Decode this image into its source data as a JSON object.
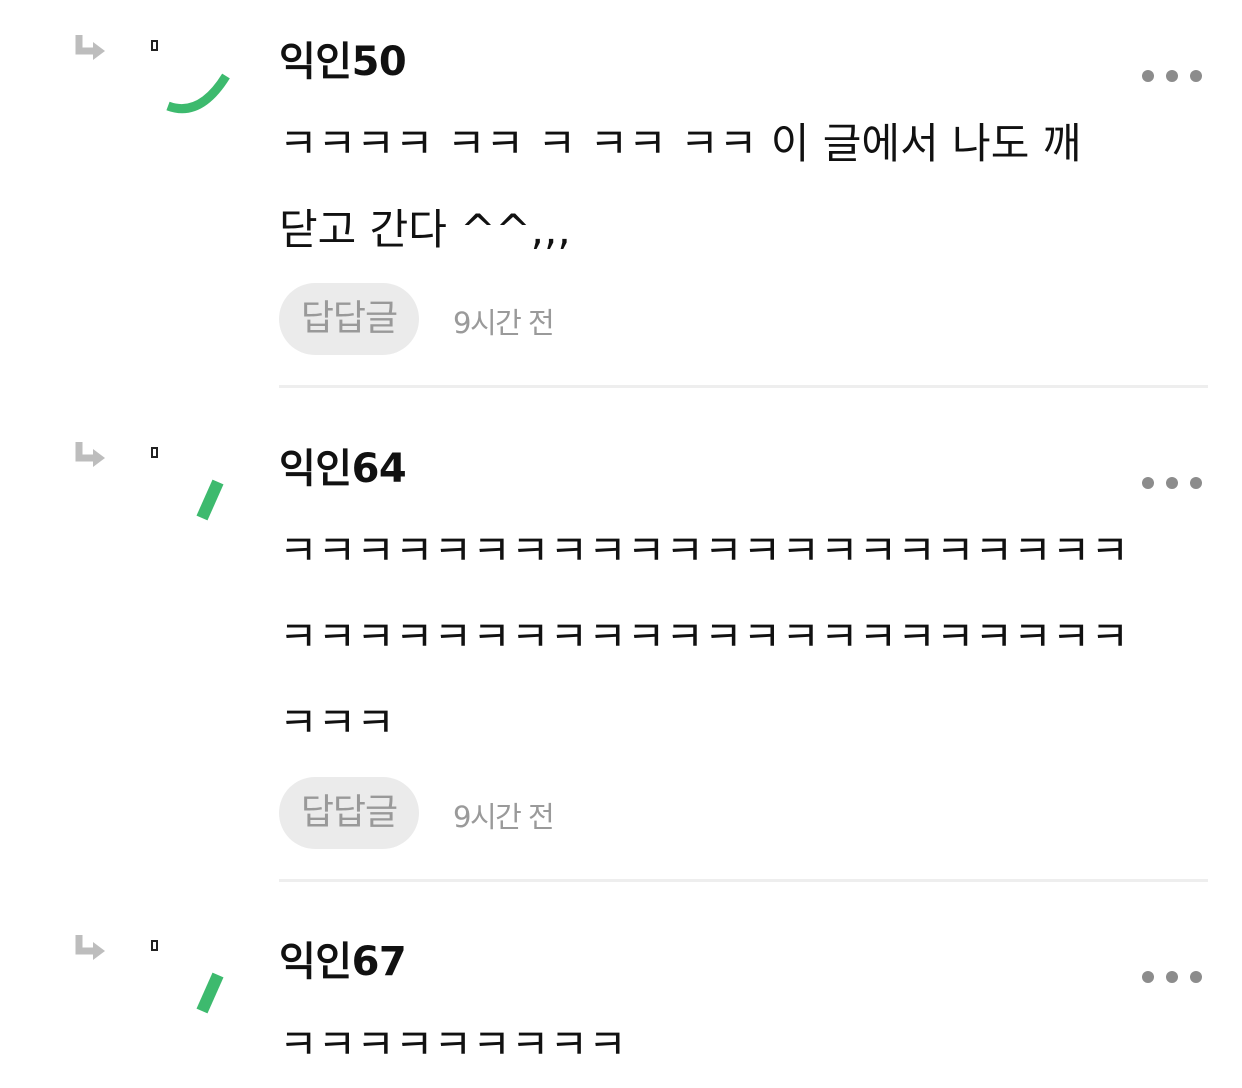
{
  "comments": [
    {
      "author": "익인50",
      "text": "ㅋㅋㅋㅋ ㅋㅋ ㅋ ㅋㅋ ㅋㅋ 이 글에서 나도 깨\n닫고 간다 ^^,,,",
      "reply_label": "답답글",
      "time": "9시간 전",
      "avatar_icon": "green-arc-avatar-icon",
      "accent": "#3dba6e"
    },
    {
      "author": "익인64",
      "text": "ㅋㅋㅋㅋㅋㅋㅋㅋㅋㅋㅋㅋㅋㅋㅋㅋㅋㅋㅋㅋㅋㅋ\nㅋㅋㅋㅋㅋㅋㅋㅋㅋㅋㅋㅋㅋㅋㅋㅋㅋㅋㅋㅋㅋㅋ\nㅋㅋㅋ",
      "reply_label": "답답글",
      "time": "9시간 전",
      "avatar_icon": "green-dash-avatar-icon",
      "accent": "#3dba6e"
    },
    {
      "author": "익인67",
      "text": "ㅋㅋㅋㅋㅋㅋㅋㅋㅋ",
      "avatar_icon": "green-dash-avatar-icon",
      "accent": "#3dba6e"
    }
  ]
}
